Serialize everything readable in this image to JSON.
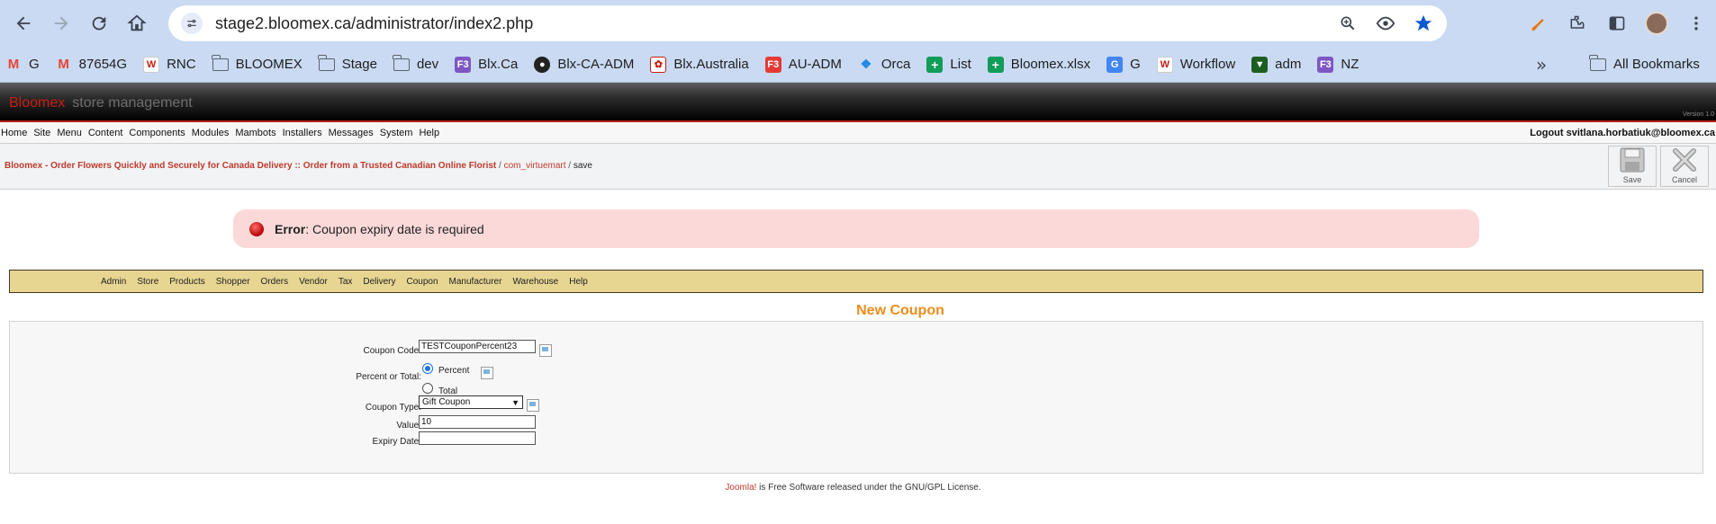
{
  "browser": {
    "url": "stage2.bloomex.ca/administrator/index2.php",
    "bookmarks": [
      {
        "label": "G",
        "icon": "gmail-icon",
        "color": "#ea4335"
      },
      {
        "label": "87654G",
        "icon": "gmail-icon",
        "color": "#ea4335"
      },
      {
        "label": "RNC",
        "icon": "wiki-icon",
        "color": "#c81e14"
      },
      {
        "label": "BLOOMEX",
        "icon": "folder-icon",
        "color": ""
      },
      {
        "label": "Stage",
        "icon": "folder-icon",
        "color": ""
      },
      {
        "label": "dev",
        "icon": "folder-icon",
        "color": ""
      },
      {
        "label": "Blx.Ca",
        "icon": "f3-icon",
        "color": "#7e57c2"
      },
      {
        "label": "Blx-CA-ADM",
        "icon": "globe-icon",
        "color": "#222"
      },
      {
        "label": "Blx.Australia",
        "icon": "site-icon",
        "color": "#c81e14"
      },
      {
        "label": "AU-ADM",
        "icon": "f3-icon",
        "color": "#e53935"
      },
      {
        "label": "Orca",
        "icon": "orca-icon",
        "color": "#1e88e5"
      },
      {
        "label": "List",
        "icon": "sheets-icon",
        "color": "#0f9d58"
      },
      {
        "label": "Bloomex.xlsx",
        "icon": "sheets-icon",
        "color": "#0f9d58"
      },
      {
        "label": "G",
        "icon": "translate-icon",
        "color": "#4285f4"
      },
      {
        "label": "Workflow",
        "icon": "wiki-icon",
        "color": "#c81e14"
      },
      {
        "label": "adm",
        "icon": "adm-icon",
        "color": "#1b5e20"
      },
      {
        "label": "NZ",
        "icon": "f3-icon",
        "color": "#7e57c2"
      }
    ],
    "all_bookmarks": "All Bookmarks"
  },
  "admin": {
    "brand_red": "Bloomex",
    "brand_grey": "store management",
    "version": "Version 1.0",
    "menu": [
      "Home",
      "Site",
      "Menu",
      "Content",
      "Components",
      "Modules",
      "Mambots",
      "Installers",
      "Messages",
      "System",
      "Help"
    ],
    "logout": "Logout svitlana.horbatiuk@bloomex.ca",
    "pathway": {
      "site": "Bloomex - Order Flowers Quickly and Securely for Canada Delivery :: Order from a Trusted Canadian Online Florist",
      "sep1": " / ",
      "component": "com_virtuemart",
      "sep2": " / ",
      "task": "save"
    },
    "toolbar": {
      "save": "Save",
      "cancel": "Cancel"
    },
    "error": {
      "label": "Error",
      "message": ": Coupon expiry date is required"
    },
    "vm_menu": [
      "Admin",
      "Store",
      "Products",
      "Shopper",
      "Orders",
      "Vendor",
      "Tax",
      "Delivery",
      "Coupon",
      "Manufacturer",
      "Warehouse",
      "Help"
    ],
    "form": {
      "title": "New Coupon",
      "code_label": "Coupon Code:",
      "code_value": "TESTCouponPercent23",
      "percent_total_label": "Percent or Total:",
      "percent_label": "Percent",
      "total_label": "Total",
      "type_label": "Coupon Type:",
      "type_value": "Gift Coupon",
      "value_label": "Value:",
      "value_value": "10",
      "expiry_label": "Expiry Date:",
      "expiry_value": ""
    },
    "footer": {
      "joomla": "Joomla!",
      "rest": " is Free Software released under the GNU/GPL License."
    }
  }
}
